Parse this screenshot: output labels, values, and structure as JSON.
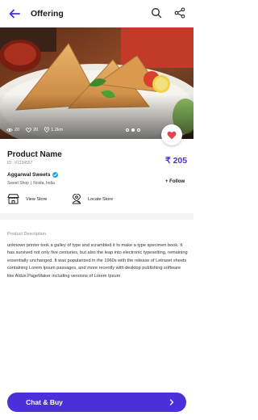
{
  "header": {
    "title": "Offering",
    "back_icon": "arrow-left-icon",
    "search_icon": "search-icon",
    "share_icon": "share-icon",
    "accent": "#4b2fd9"
  },
  "hero": {
    "image_subject": "samosa plate",
    "stats": {
      "views": "20",
      "likes": "20",
      "distance": "1.2km"
    },
    "carousel_dots": 3,
    "active_dot": 1
  },
  "product": {
    "name": "Product Name",
    "id": "ID : #1234557",
    "price": "₹ 205"
  },
  "shop": {
    "name": "Aggarwal Sweets",
    "type": "Sweet Shop",
    "location": "Noida, India",
    "follow_label": "+ Follow"
  },
  "actions": {
    "view_store": "View Store",
    "locate_store": "Locate Store"
  },
  "description": {
    "label": "Product Description",
    "text": "unknown printer took a galley of type and scrambled it to make a type specimen book. It has survived not only five centuries, but also the leap into electronic typesetting, remaining essentially unchanged. It was popularised in the 1960s with the release of Letraset sheets containing Lorem Ipsum passages, and more recently with desktop publishing software like Aldus PageMaker including versions of Lorem Ipsum"
  },
  "cta": {
    "label": "Chat & Buy"
  },
  "colors": {
    "accent": "#4b2fd9",
    "favorite": "#e0454c",
    "verified": "#1ba8e6"
  }
}
